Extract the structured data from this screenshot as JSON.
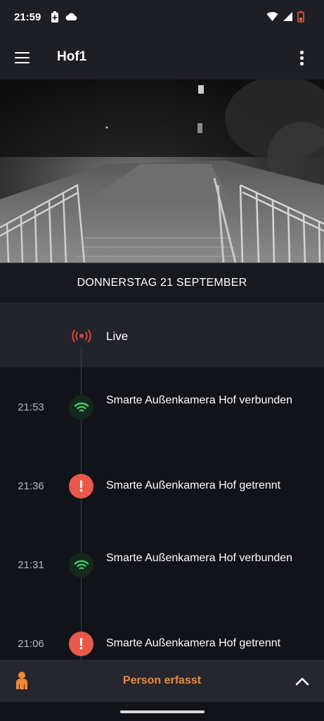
{
  "status_bar": {
    "time": "21:59",
    "left_icons": [
      "battery-saver-icon",
      "cloud-icon"
    ],
    "right_icons": [
      "wifi-icon",
      "cellular-icon",
      "battery-low-icon"
    ]
  },
  "app_bar": {
    "title": "Hof1",
    "menu_icon": "menu-icon",
    "more_icon": "more-vert-icon"
  },
  "camera": {
    "scene": "night-vision-stairway"
  },
  "timeline": {
    "date_header": "DONNERSTAG 21 SEPTEMBER",
    "live": {
      "label": "Live",
      "icon": "live-broadcast-icon",
      "color": "#e0443a"
    },
    "events": [
      {
        "time": "21:53",
        "text": "Smarte Außenkamera Hof verbunden",
        "type": "connected",
        "icon": "wifi-icon",
        "color": "#4cc76a"
      },
      {
        "time": "21:36",
        "text": "Smarte Außenkamera Hof getrennt",
        "type": "disconnected",
        "icon": "alert-icon",
        "color": "#e9594b"
      },
      {
        "time": "21:31",
        "text": "Smarte Außenkamera Hof verbunden",
        "type": "connected",
        "icon": "wifi-icon",
        "color": "#4cc76a"
      },
      {
        "time": "21:06",
        "text": "Smarte Außenkamera Hof getrennt",
        "type": "disconnected",
        "icon": "alert-icon",
        "color": "#e9594b"
      }
    ]
  },
  "bottom_bar": {
    "label": "Person erfasst",
    "icon": "person-icon",
    "accent": "#f08a35",
    "expand_icon": "chevron-up-icon"
  }
}
